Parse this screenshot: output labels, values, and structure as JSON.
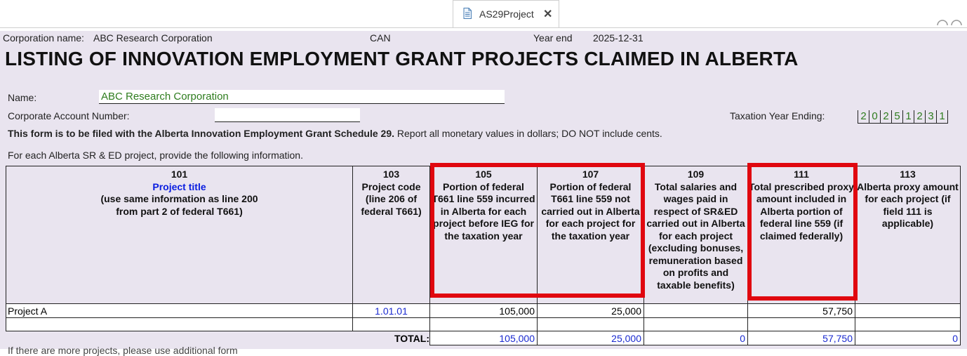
{
  "tab": {
    "label": "AS29Project",
    "close_glyph": "✕"
  },
  "header": {
    "corporation_label": "Corporation name:",
    "corporation_name": "ABC Research Corporation",
    "country": "CAN",
    "year_end_label": "Year end",
    "year_end": "2025-12-31"
  },
  "form": {
    "title": "LISTING OF INNOVATION EMPLOYMENT GRANT PROJECTS CLAIMED IN ALBERTA",
    "name_label": "Name:",
    "name_value": "ABC Research Corporation",
    "account_label": "Corporate Account Number:",
    "account_value": "",
    "tax_year_label": "Taxation Year Ending:",
    "tax_year_digits": [
      "2",
      "0",
      "2",
      "5",
      "1",
      "2",
      "3",
      "1"
    ],
    "notice_bold": "This form is to be filed with the Alberta Innovation Employment Grant Schedule 29.",
    "notice_rest": " Report all monetary values in dollars; DO NOT include cents.",
    "instruction": "For each Alberta SR & ED project, provide the following information.",
    "footer_partial": "If there are more projects, please use additional form"
  },
  "table": {
    "columns": [
      {
        "code": "101",
        "title": "Project title",
        "desc": "(use same information as line 200 from part 2 of federal T661)"
      },
      {
        "code": "103",
        "desc": "Project code (line 206 of federal T661)"
      },
      {
        "code": "105",
        "desc": "Portion of federal T661 line 559 incurred in Alberta for each project before IEG for the taxation year"
      },
      {
        "code": "107",
        "desc": "Portion of federal T661 line 559 not carried out in Alberta for each project for the taxation year"
      },
      {
        "code": "109",
        "desc": "Total salaries and wages paid in respect of SR&ED carried out in Alberta for each project (excluding bonuses, remuneration based on profits and taxable benefits)"
      },
      {
        "code": "111",
        "desc": "Total prescribed proxy amount included in Alberta portion of federal line 559 (if claimed federally)"
      },
      {
        "code": "113",
        "desc": "Alberta proxy amount for each project (if field 111 is applicable)"
      }
    ],
    "rows": [
      {
        "title": "Project A",
        "code": "1.01.01",
        "c105": "105,000",
        "c107": "25,000",
        "c109": "",
        "c111": "57,750",
        "c113": ""
      }
    ],
    "total": {
      "label": "TOTAL:",
      "c105": "105,000",
      "c107": "25,000",
      "c109": "0",
      "c111": "57,750",
      "c113": "0"
    }
  },
  "highlight_color": "#e0070f"
}
